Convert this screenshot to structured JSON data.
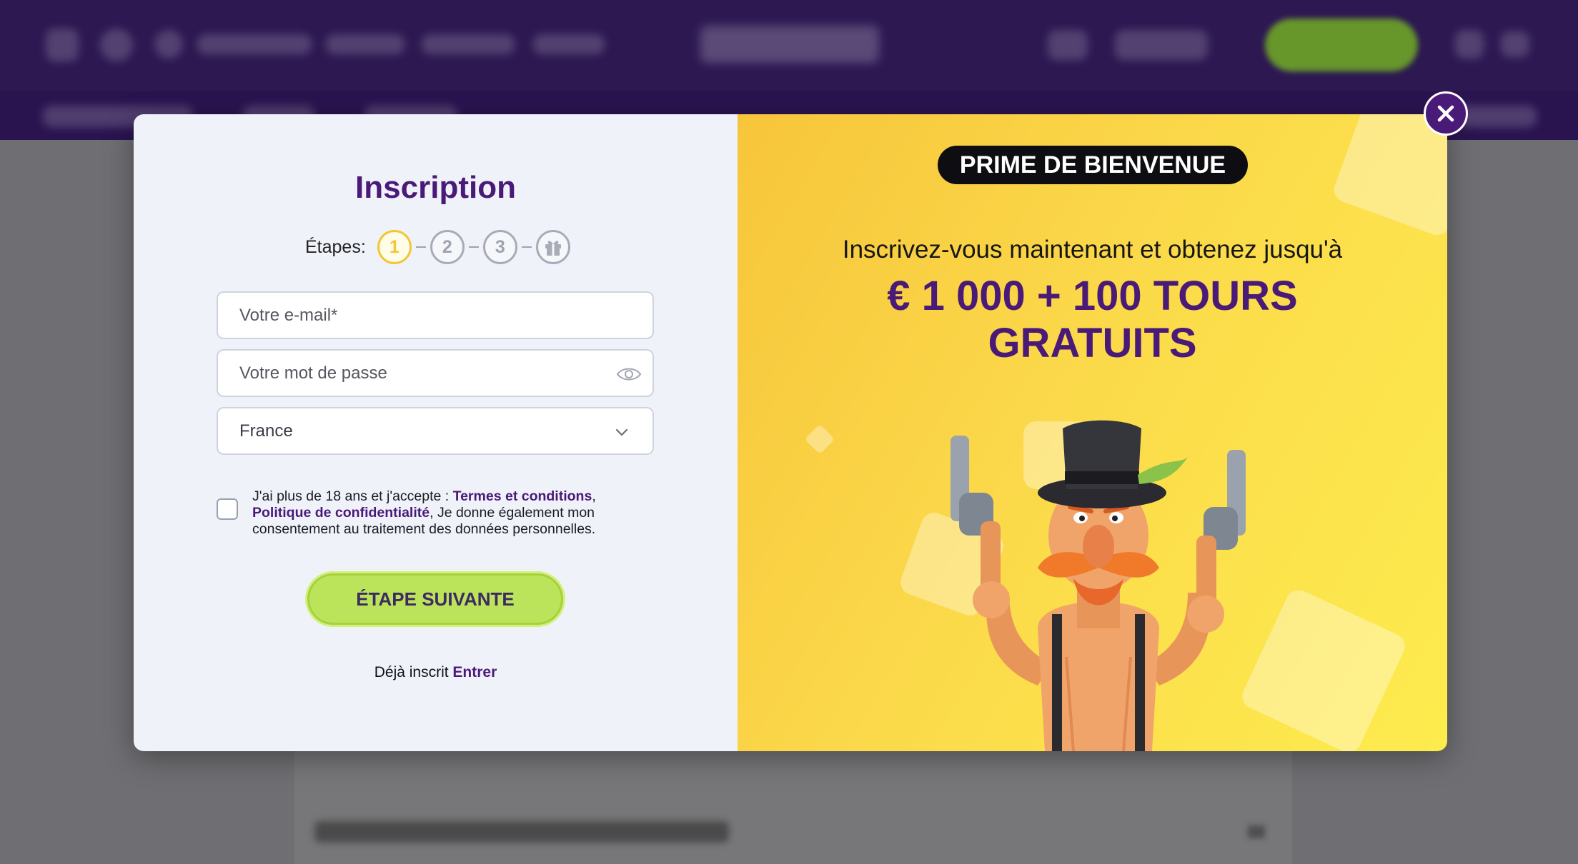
{
  "modal": {
    "title": "Inscription",
    "steps": {
      "label": "Étapes:",
      "items": [
        "1",
        "2",
        "3"
      ],
      "active_step": 1,
      "final_icon": "gift-icon"
    },
    "form": {
      "email_placeholder": "Votre e-mail*",
      "password_placeholder": "Votre mot de passe",
      "country_value": "France",
      "password_icon": "eye-icon",
      "country_icon": "chevron-down-icon"
    },
    "terms": {
      "prefix": "J'ai plus de 18 ans et j'accepte : ",
      "terms_link": "Termes et conditions",
      "sep": ",",
      "privacy_link": "Politique de confidentialité",
      "suffix": ", Je donne également mon consentement au traitement des données personnelles.",
      "checked": false
    },
    "next_button": "ÉTAPE SUIVANTE",
    "login": {
      "prefix": "Déjà inscrit ",
      "link": "Entrer"
    },
    "close_icon": "close-icon"
  },
  "promo": {
    "badge": "PRIME DE BIENVENUE",
    "subtitle": "Inscrivez-vous maintenant et obtenez jusqu'à",
    "amount_line1": "€ 1 000 + 100 TOURS",
    "amount_line2": "GRATUITS",
    "illustration": "cowboy-mascot-illustration"
  },
  "colors": {
    "brand_purple": "#4a1a78",
    "cta_green": "#bce45a",
    "promo_yellow": "#fbd94a",
    "step_active": "#f2c634"
  }
}
